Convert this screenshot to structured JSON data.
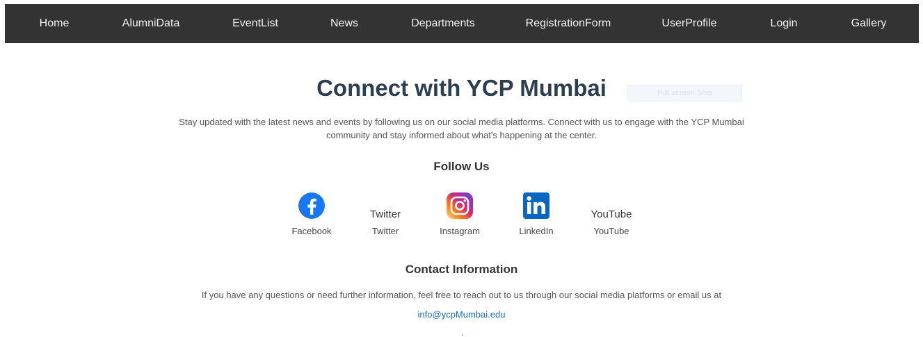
{
  "nav": {
    "items": [
      {
        "label": "Home"
      },
      {
        "label": "AlumniData"
      },
      {
        "label": "EventList"
      },
      {
        "label": "News"
      },
      {
        "label": "Departments"
      },
      {
        "label": "RegistrationForm"
      },
      {
        "label": "UserProfile"
      },
      {
        "label": "Login"
      },
      {
        "label": "Gallery"
      }
    ]
  },
  "main": {
    "title": "Connect with YCP Mumbai",
    "overlay_text": "Full screen Snip",
    "intro": "Stay updated with the latest news and events by following us on our social media platforms. Connect with us to engage with the YCP Mumbai community and stay informed about what's happening at the center."
  },
  "follow": {
    "heading": "Follow Us",
    "items": [
      {
        "name": "Facebook",
        "icon": "facebook-icon",
        "alt": ""
      },
      {
        "name": "Twitter",
        "icon": "twitter-icon-broken",
        "alt": "Twitter"
      },
      {
        "name": "Instagram",
        "icon": "instagram-icon",
        "alt": ""
      },
      {
        "name": "LinkedIn",
        "icon": "linkedin-icon",
        "alt": ""
      },
      {
        "name": "YouTube",
        "icon": "youtube-icon-broken",
        "alt": "YouTube"
      }
    ]
  },
  "contact": {
    "heading": "Contact Information",
    "text": "If you have any questions or need further information, feel free to reach out to us through our social media platforms or email us at",
    "email": "info@ycpMumbai.edu"
  },
  "colors": {
    "navbar": "#333333",
    "title": "#2c3e50",
    "link": "#1a6fb5",
    "facebook": "#1877f2",
    "linkedin": "#0a66c2"
  }
}
